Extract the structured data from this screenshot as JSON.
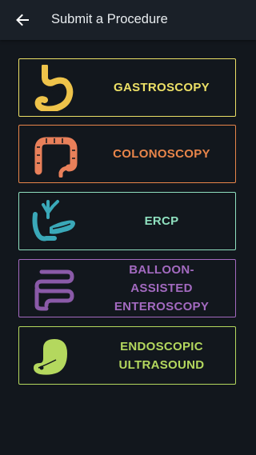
{
  "header": {
    "title": "Submit a Procedure",
    "back_icon": "arrow-left-icon"
  },
  "procedures": [
    {
      "label": "GASTROSCOPY",
      "color": "#ece066",
      "icon": "stomach-icon"
    },
    {
      "label": "COLONOSCOPY",
      "color": "#e8854a",
      "icon": "colon-icon"
    },
    {
      "label": "ERCP",
      "color": "#8fe0bf",
      "icon": "pancreas-icon"
    },
    {
      "label": "BALLOON-\nASSISTED\nENTEROSCOPY",
      "color": "#a36ac0",
      "icon": "small-intestine-icon"
    },
    {
      "label": "ENDOSCOPIC\nULTRASOUND",
      "color": "#b4d85e",
      "icon": "ultrasound-stomach-icon"
    }
  ]
}
